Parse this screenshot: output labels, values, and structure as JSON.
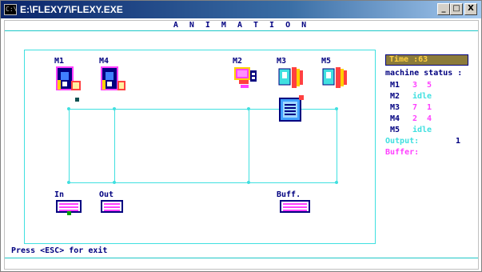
{
  "window": {
    "title": "E:\\FLEXY7\\FLEXY.EXE",
    "icon": "console-icon",
    "icon_text": "C:\\",
    "buttons": {
      "minimize": "_",
      "maximize": "□",
      "close": "X"
    }
  },
  "header": {
    "title": "A N I M A T I O N"
  },
  "machines": {
    "m1": "M1",
    "m4": "M4",
    "m2": "M2",
    "m3": "M3",
    "m5": "M5"
  },
  "stations": {
    "in": "In",
    "out": "Out",
    "buff": "Buff."
  },
  "status_panel": {
    "time": "Time :63",
    "heading": "machine status :",
    "rows": [
      {
        "name": "M1",
        "value": "3  5"
      },
      {
        "name": "M2",
        "value": "idle"
      },
      {
        "name": "M3",
        "value": "7  1"
      },
      {
        "name": "M4",
        "value": "2  4"
      },
      {
        "name": "M5",
        "value": "idle"
      }
    ],
    "output_label": "Output:",
    "output_value": "1",
    "buffer_label": "Buffer:"
  },
  "footer": {
    "exit_message": "Press <ESC> for exit"
  },
  "colors": {
    "cyan": "#40e0e0",
    "navy": "#000080",
    "magenta": "#ff40ff",
    "time_bg": "#8b7b3a",
    "time_fg": "#ffd040"
  }
}
